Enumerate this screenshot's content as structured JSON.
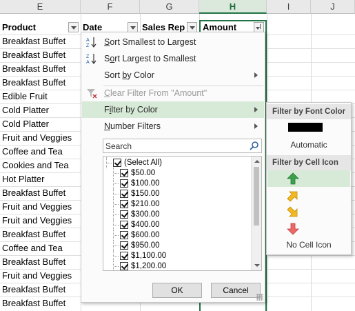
{
  "columns": [
    "E",
    "F",
    "G",
    "H",
    "I",
    "J"
  ],
  "selected_column": "H",
  "headers": {
    "product": "Product",
    "date": "Date",
    "sales_rep": "Sales Rep",
    "amount": "Amount"
  },
  "products": [
    "Breakfast Buffet",
    "Breakfast Buffet",
    "Breakfast Buffet",
    "Breakfast Buffet",
    "Edible Fruit",
    "Cold Platter",
    "Cold Platter",
    "Fruit and Veggies",
    "Coffee and Tea",
    "Cookies and Tea",
    "Hot Platter",
    "Breakfast Buffet",
    "Fruit and Veggies",
    "Fruit and Veggies",
    "Breakfast Buffet",
    "Coffee and Tea",
    "Breakfast Buffet",
    "Fruit and Veggies",
    "Breakfast Buffet",
    "Breakfast Buffet"
  ],
  "menu": {
    "sort_asc": "Sort Smallest to Largest",
    "sort_desc": "Sort Largest to Smallest",
    "sort_color": "Sort by Color",
    "clear_filter": "Clear Filter From \"Amount\"",
    "filter_color": "Filter by Color",
    "number_filters": "Number Filters",
    "search_placeholder": "Search",
    "values": [
      "(Select All)",
      "$50.00",
      "$100.00",
      "$150.00",
      "$210.00",
      "$300.00",
      "$400.00",
      "$600.00",
      "$950.00",
      "$1,100.00",
      "$1,200.00"
    ],
    "ok": "OK",
    "cancel": "Cancel"
  },
  "submenu": {
    "font_color_header": "Filter by Font Color",
    "font_color_swatch": "#000000",
    "automatic": "Automatic",
    "cell_icon_header": "Filter by Cell Icon",
    "icons": [
      "green-up-arrow-icon",
      "yellow-up-right-arrow-icon",
      "yellow-down-right-arrow-icon",
      "red-down-arrow-icon"
    ],
    "no_cell_icon": "No Cell Icon"
  },
  "colors": {
    "accent": "#217346",
    "highlight": "#d7e9d7"
  }
}
